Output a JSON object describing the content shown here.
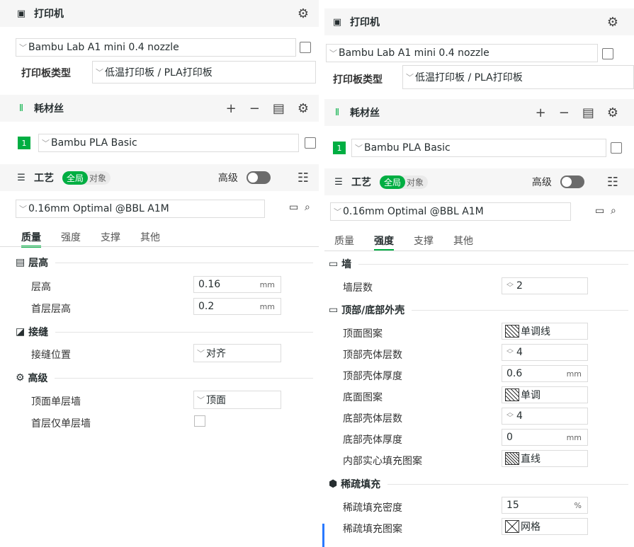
{
  "left": {
    "printer": {
      "title": "打印机",
      "preset": "Bambu Lab A1 mini 0.4 nozzle",
      "plate_label": "打印板类型",
      "plate_value": "低温打印板 / PLA打印板"
    },
    "filament": {
      "title": "耗材丝",
      "add": "+",
      "remove": "−",
      "number": "1",
      "preset": "Bambu PLA Basic"
    },
    "process": {
      "title": "工艺",
      "global": "全局",
      "object": "对象",
      "advanced": "高级",
      "preset": "0.16mm Optimal @BBL A1M"
    },
    "tabs": [
      "质量",
      "强度",
      "支撑",
      "其他"
    ],
    "groups": {
      "layer": {
        "title": "层高",
        "rows": [
          {
            "label": "层高",
            "value": "0.16",
            "unit": "mm"
          },
          {
            "label": "首层层高",
            "value": "0.2",
            "unit": "mm"
          }
        ]
      },
      "seam": {
        "title": "接缝",
        "rows": [
          {
            "label": "接缝位置",
            "value": "对齐"
          }
        ]
      },
      "adv": {
        "title": "高级",
        "rows": [
          {
            "label": "顶面单层墙",
            "value": "顶面"
          },
          {
            "label": "首层仅单层墙",
            "value": ""
          }
        ]
      }
    }
  },
  "right": {
    "printer": {
      "title": "打印机",
      "preset": "Bambu Lab A1 mini 0.4 nozzle",
      "plate_label": "打印板类型",
      "plate_value": "低温打印板 / PLA打印板"
    },
    "filament": {
      "title": "耗材丝",
      "add": "+",
      "remove": "−",
      "number": "1",
      "preset": "Bambu PLA Basic"
    },
    "process": {
      "title": "工艺",
      "global": "全局",
      "object": "对象",
      "advanced": "高级",
      "preset": "0.16mm Optimal @BBL A1M"
    },
    "tabs": [
      "质量",
      "强度",
      "支撑",
      "其他"
    ],
    "groups": {
      "wall": {
        "title": "墙",
        "rows": [
          {
            "label": "墙层数",
            "value": "2"
          }
        ]
      },
      "shell": {
        "title": "顶部/底部外壳",
        "rows": [
          {
            "label": "顶面图案",
            "value": "单调线"
          },
          {
            "label": "顶部壳体层数",
            "value": "4"
          },
          {
            "label": "顶部壳体厚度",
            "value": "0.6",
            "unit": "mm"
          },
          {
            "label": "底面图案",
            "value": "单调"
          },
          {
            "label": "底部壳体层数",
            "value": "4"
          },
          {
            "label": "底部壳体厚度",
            "value": "0",
            "unit": "mm"
          },
          {
            "label": "内部实心填充图案",
            "value": "直线"
          }
        ]
      },
      "infill": {
        "title": "稀疏填充",
        "rows": [
          {
            "label": "稀疏填充密度",
            "value": "15",
            "unit": "%"
          },
          {
            "label": "稀疏填充图案",
            "value": "网格"
          }
        ]
      }
    }
  },
  "colors": {
    "accent": "#00ae42",
    "section_bg": "#f6f6f6"
  }
}
